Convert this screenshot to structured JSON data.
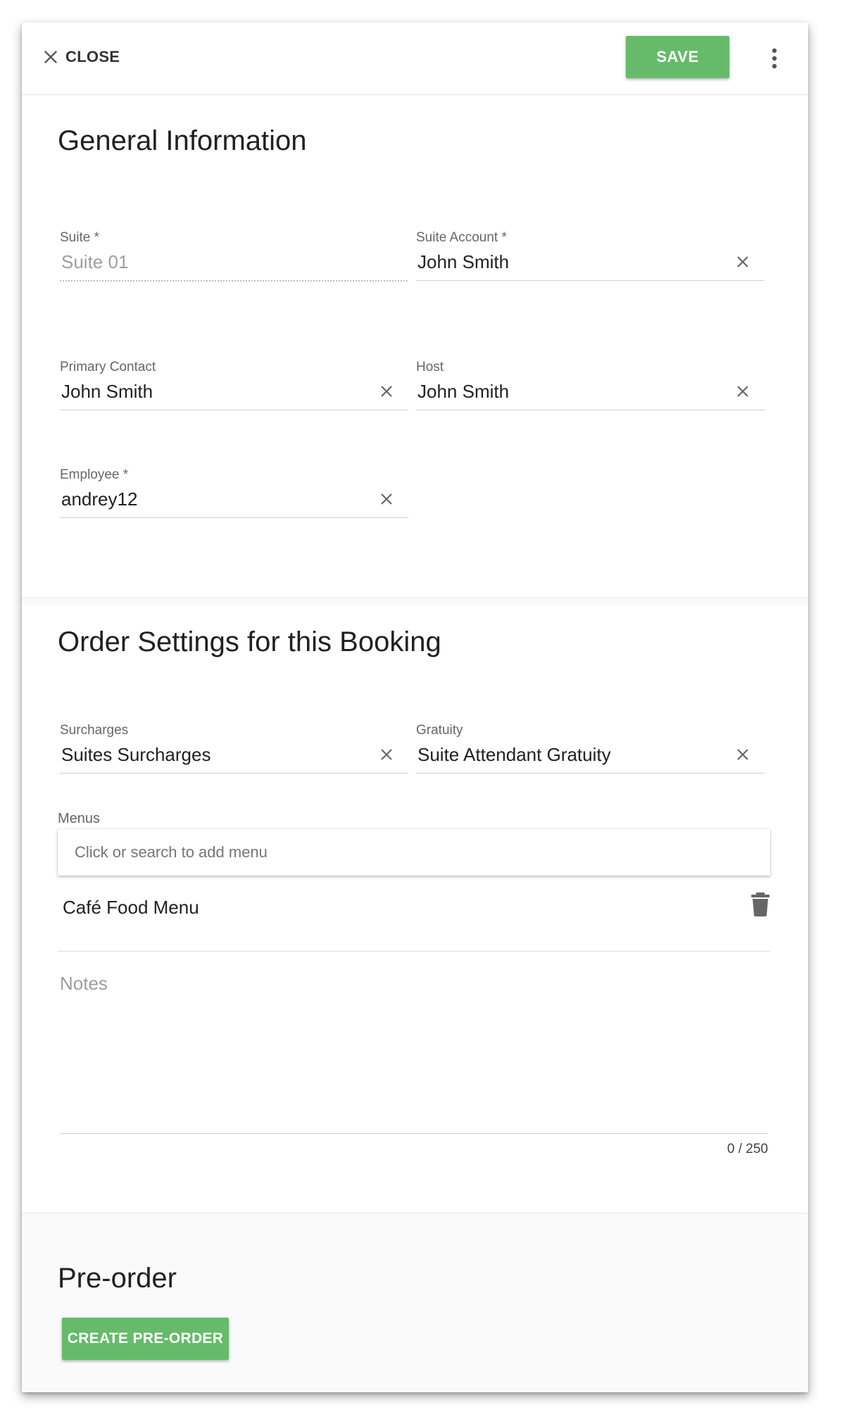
{
  "toolbar": {
    "close_label": "CLOSE",
    "save_label": "SAVE"
  },
  "general": {
    "title": "General Information",
    "suite": {
      "label": "Suite *",
      "value": "Suite 01"
    },
    "suite_account": {
      "label": "Suite Account *",
      "value": "John Smith"
    },
    "primary_contact": {
      "label": "Primary Contact",
      "value": "John Smith"
    },
    "host": {
      "label": "Host",
      "value": "John Smith"
    },
    "employee": {
      "label": "Employee *",
      "value": "andrey12"
    }
  },
  "order": {
    "title": "Order Settings for this Booking",
    "surcharges": {
      "label": "Surcharges",
      "value": "Suites Surcharges"
    },
    "gratuity": {
      "label": "Gratuity",
      "value": "Suite Attendant Gratuity"
    },
    "menus": {
      "label": "Menus",
      "placeholder": "Click or search to add menu",
      "items": [
        {
          "label": "Café Food Menu"
        }
      ]
    },
    "notes": {
      "placeholder": "Notes",
      "value": "",
      "counter": "0 / 250"
    }
  },
  "preorder": {
    "title": "Pre-order",
    "button_label": "CREATE PRE-ORDER"
  },
  "colors": {
    "accent": "#66bb6a",
    "text": "#212121",
    "label": "#666666"
  }
}
